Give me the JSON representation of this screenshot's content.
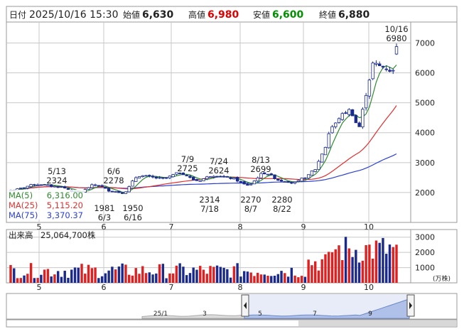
{
  "header": {
    "date_label": "日付",
    "datetime": "2025/10/16 15:30",
    "open_label": "始値",
    "open_value": "6,630",
    "high_label": "高値",
    "high_value": "6,980",
    "low_label": "安値",
    "low_value": "6,600",
    "close_label": "終値",
    "close_value": "6,880"
  },
  "legend": {
    "ma5": {
      "label": "MA(5)",
      "value": "6,316.00",
      "color": "#2e8b2e"
    },
    "ma25": {
      "label": "MA(25)",
      "value": "5,115.20",
      "color": "#e03030"
    },
    "ma75": {
      "label": "MA(75)",
      "value": "3,370.37",
      "color": "#2a3fcf"
    }
  },
  "volume_panel": {
    "label": "出来高",
    "value": "25,064,700株",
    "unit": "(万株)"
  },
  "navigator": {
    "labels": [
      "25/1",
      "3",
      "5",
      "7",
      "9"
    ]
  },
  "colors": {
    "up": "#ffffff",
    "down": "#1a2a8c",
    "vol_up": "#e02020",
    "vol_down": "#1a2a8c",
    "grid": "#c8c8c8",
    "high_value": "#e00000",
    "low_value": "#009000"
  },
  "chart_data": {
    "type": "candlestick",
    "x_tick_labels": [
      "5",
      "6",
      "7",
      "8",
      "9",
      "10"
    ],
    "price_axis": {
      "ticks": [
        2000,
        3000,
        4000,
        5000,
        6000,
        7000
      ],
      "ylim": [
        1000,
        7700
      ]
    },
    "volume_axis": {
      "ticks": [
        1000,
        2000,
        3000
      ],
      "unit": "(万株)",
      "ylim": [
        0,
        3500
      ]
    },
    "annotations": [
      {
        "date": "5/13",
        "value": "2324"
      },
      {
        "date": "6/3",
        "value": "1981"
      },
      {
        "date": "6/6",
        "value": "2278"
      },
      {
        "date": "6/16",
        "value": "1950"
      },
      {
        "date": "7/9",
        "value": "2725"
      },
      {
        "date": "7/18",
        "value": "2314"
      },
      {
        "date": "7/24",
        "value": "2624"
      },
      {
        "date": "8/7",
        "value": "2270"
      },
      {
        "date": "8/13",
        "value": "2699"
      },
      {
        "date": "8/22",
        "value": "2280"
      },
      {
        "date": "10/16",
        "value": "6980"
      }
    ],
    "moving_averages": [
      {
        "name": "MA(5)",
        "last": 6316.0
      },
      {
        "name": "MA(25)",
        "last": 5115.2
      },
      {
        "name": "MA(75)",
        "last": 3370.37
      }
    ],
    "last_candle": {
      "date": "2025/10/16",
      "open": 6630,
      "high": 6980,
      "low": 6600,
      "close": 6880,
      "volume": 25064700
    }
  }
}
